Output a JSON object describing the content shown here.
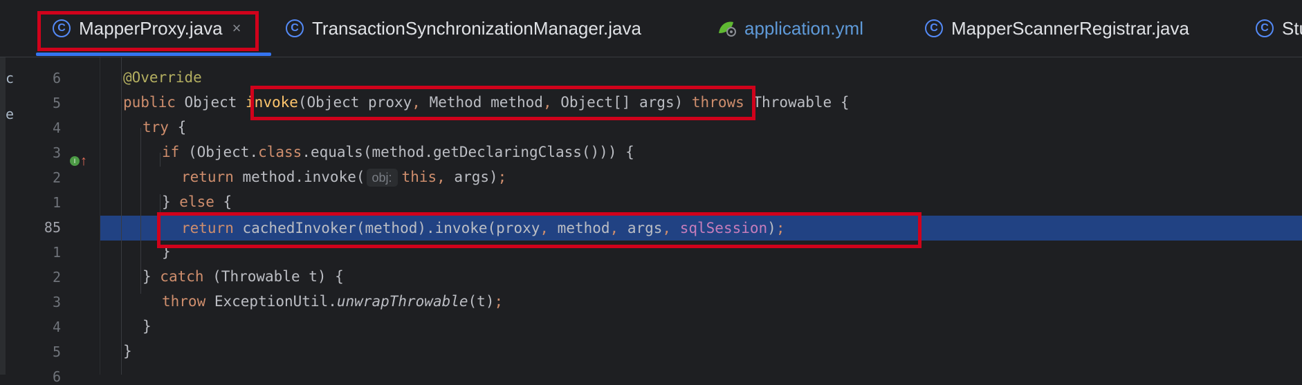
{
  "tabs": [
    {
      "label": "MapperProxy.java",
      "icon": "class-icon",
      "active": true,
      "close": "×"
    },
    {
      "label": "TransactionSynchronizationManager.java",
      "icon": "class-icon"
    },
    {
      "label": "application.yml",
      "icon": "yaml-spring-icon"
    },
    {
      "label": "MapperScannerRegistrar.java",
      "icon": "class-icon"
    },
    {
      "label": "Stu",
      "icon": "class-icon"
    }
  ],
  "class_icon_glyph": "C",
  "edge_glyphs": [
    "c",
    "e"
  ],
  "line_numbers": [
    "6",
    "5",
    "4",
    "3",
    "2",
    "1",
    "85",
    "1",
    "2",
    "3",
    "4",
    "5",
    "6"
  ],
  "code": {
    "l1": {
      "ann": "@Override"
    },
    "l2": {
      "public": "public",
      "type": "Object",
      "name": "invoke",
      "params": "(Object proxy",
      "c1": ",",
      "p2": " Method method",
      "c2": ",",
      "p3": " Object[] args)",
      "throws": "throws",
      "ex": " Throwable {"
    },
    "l3": {
      "try": "try",
      "rest": " {"
    },
    "l4": {
      "if": "if",
      "a": " (Object.",
      "cls": "class",
      "b": ".equals(method.getDeclaringClass())) {"
    },
    "l5": {
      "ret": "return",
      "a": " method.invoke(",
      "hint": "obj:",
      "this": "this",
      "comma": ",",
      "b": " args)",
      "semi": ";"
    },
    "l6": {
      "a": "} ",
      "else": "else",
      "b": " {"
    },
    "l7": {
      "ret": "return",
      "a": " cachedInvoker(method).invoke(proxy",
      "c1": ",",
      "b": " method",
      "c2": ",",
      "c": " args",
      "c3": ",",
      "fld": "sqlSession",
      "d": ")",
      "semi": ";"
    },
    "l8": {
      "a": "}"
    },
    "l9": {
      "a": "} ",
      "catch": "catch",
      "b": " (Throwable t) {"
    },
    "l10": {
      "throw": "throw",
      "a": " ExceptionUtil.",
      "m": "unwrapThrowable",
      "b": "(t)",
      "semi": ";"
    },
    "l11": {
      "a": "}"
    },
    "l12": {
      "a": "}"
    }
  },
  "colors": {
    "accent": "#3574f0",
    "highlight": "#214283",
    "annotation_box": "#d0021b"
  }
}
